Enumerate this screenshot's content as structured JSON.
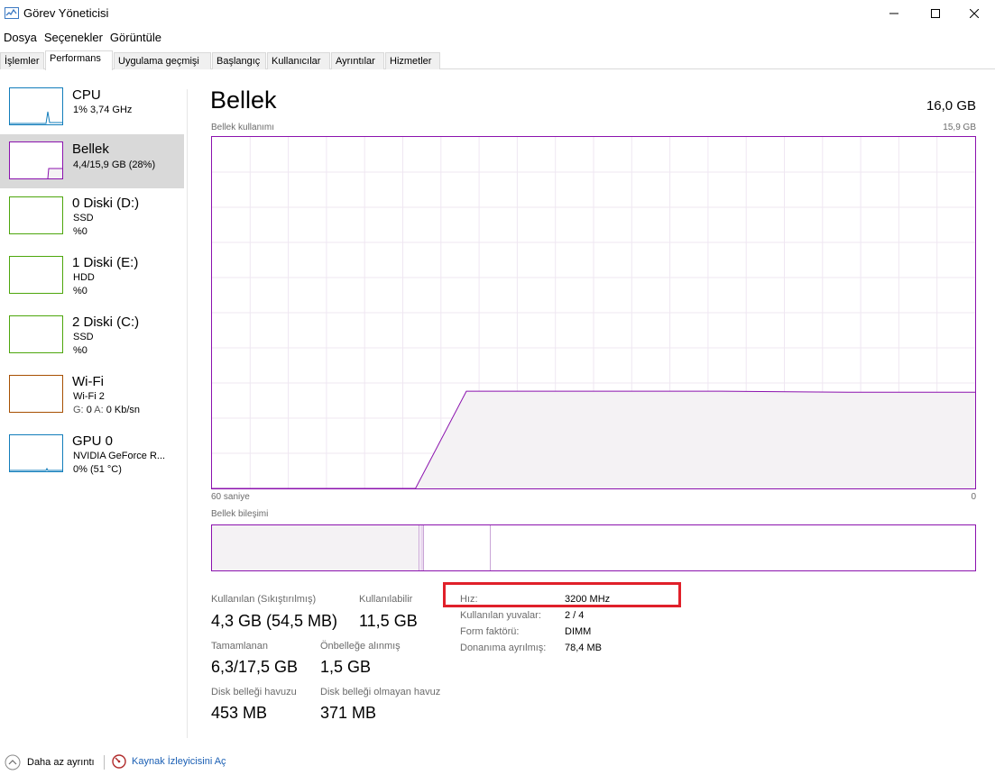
{
  "window": {
    "title": "Görev Yöneticisi"
  },
  "menu": [
    "Dosya",
    "Seçenekler",
    "Görüntüle"
  ],
  "tabs": [
    "İşlemler",
    "Performans",
    "Uygulama geçmişi",
    "Başlangıç",
    "Kullanıcılar",
    "Ayrıntılar",
    "Hizmetler"
  ],
  "active_tab": "Performans",
  "sidebar": {
    "items": [
      {
        "title": "CPU",
        "line1": "1% 3,74 GHz",
        "line2": "",
        "color": "#117dbb",
        "selected": false
      },
      {
        "title": "Bellek",
        "line1": "4,4/15,9 GB (28%)",
        "line2": "",
        "color": "#8b12ae",
        "selected": true
      },
      {
        "title": "0 Diski (D:)",
        "line1": "SSD",
        "line2": "%0",
        "color": "#4da60c",
        "selected": false
      },
      {
        "title": "1 Diski (E:)",
        "line1": "HDD",
        "line2": "%0",
        "color": "#4da60c",
        "selected": false
      },
      {
        "title": "2 Diski (C:)",
        "line1": "SSD",
        "line2": "%0",
        "color": "#4da60c",
        "selected": false
      },
      {
        "title": "Wi-Fi",
        "line1": "Wi-Fi 2",
        "line2_g": "G:",
        "line2_g_val": "0",
        "line2_a": "A:",
        "line2_a_val": "0 Kb/sn",
        "color": "#a74f01",
        "selected": false
      },
      {
        "title": "GPU 0",
        "line1": "NVIDIA GeForce R...",
        "line2": "0% (51 °C)",
        "color": "#117dbb",
        "selected": false
      }
    ]
  },
  "main": {
    "title": "Bellek",
    "total": "16,0 GB",
    "usage_label": "Bellek kullanımı",
    "usage_max": "15,9 GB",
    "time_left": "60 saniye",
    "time_right": "0",
    "composition_label": "Bellek bileşimi",
    "stats": {
      "used_label": "Kullanılan (Sıkıştırılmış)",
      "used_value": "4,3 GB (54,5 MB)",
      "available_label": "Kullanılabilir",
      "available_value": "11,5 GB",
      "committed_label": "Tamamlanan",
      "committed_value": "6,3/17,5 GB",
      "cached_label": "Önbelleğe alınmış",
      "cached_value": "1,5 GB",
      "paged_label": "Disk belleği havuzu",
      "paged_value": "453 MB",
      "nonpaged_label": "Disk belleği olmayan havuz",
      "nonpaged_value": "371 MB"
    },
    "info": [
      {
        "label": "Hız:",
        "value": "3200 MHz"
      },
      {
        "label": "Kullanılan yuvalar:",
        "value": "2 / 4"
      },
      {
        "label": "Form faktörü:",
        "value": "DIMM"
      },
      {
        "label": "Donanıma ayrılmış:",
        "value": "78,4 MB"
      }
    ]
  },
  "footer": {
    "fewer_details": "Daha az ayrıntı",
    "open_monitor": "Kaynak İzleyicisini Aç"
  },
  "colors": {
    "memory": "#8b12ae",
    "memory_fill": "#f4f2f4",
    "highlight": "#e0202a"
  },
  "chart_data": {
    "type": "area",
    "title": "Bellek kullanımı",
    "x_range_seconds": [
      60,
      0
    ],
    "ylim_gb": [
      0,
      15.9
    ],
    "series": [
      {
        "x": [
          60,
          57,
          55,
          47,
          44,
          40,
          35,
          30,
          25,
          20,
          10,
          0
        ],
        "y": [
          0,
          0,
          0,
          0,
          0,
          4.4,
          4.4,
          4.4,
          4.4,
          4.4,
          4.35,
          4.35
        ]
      }
    ]
  }
}
